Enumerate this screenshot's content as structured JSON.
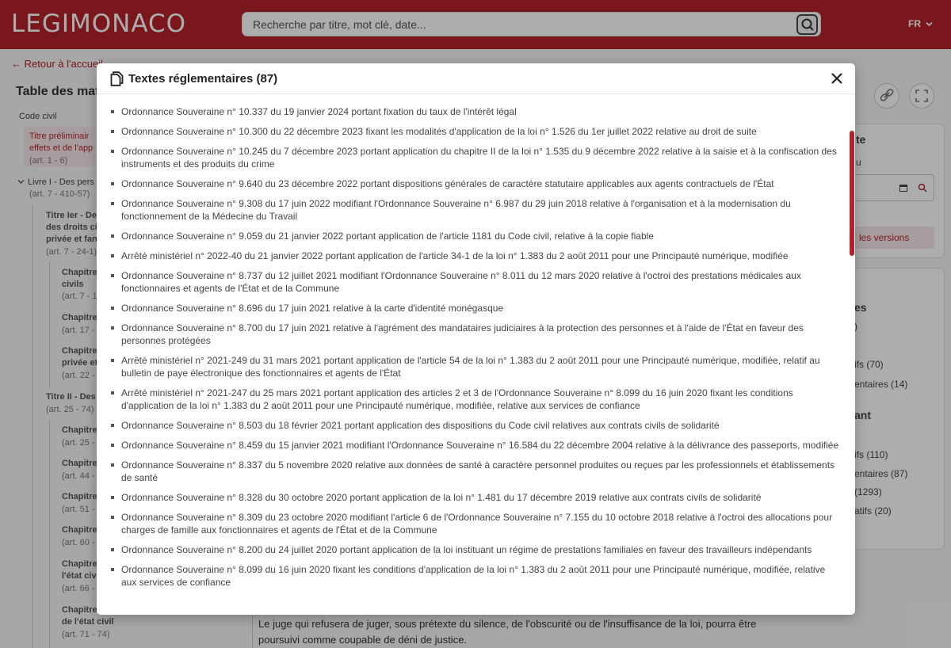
{
  "header": {
    "logo": "LEGIMONACO",
    "search_placeholder": "Recherche par titre, mot clé, date...",
    "lang": "FR"
  },
  "page": {
    "back_link": "Retour à l'accueil",
    "toc_title": "Table des mat",
    "code": "Code civil",
    "toc": [
      {
        "text": "Titre préliminair",
        "style": "red"
      },
      {
        "text": "effets et de l'app",
        "style": "red"
      },
      {
        "text": "(art. 1 - 6)",
        "style": "grey"
      },
      {
        "text": "Livre I - Des pers",
        "style": "normal"
      },
      {
        "text": "(art. 7 - 410-57)",
        "style": "grey"
      },
      {
        "text": "Titre Ier - De",
        "style": "bold"
      },
      {
        "text": "des droits civ",
        "style": "bold"
      },
      {
        "text": "privée et fan",
        "style": "bold"
      },
      {
        "text": "(art. 7 - 24-1)",
        "style": "grey"
      },
      {
        "text": "Chapitre",
        "style": "bold"
      },
      {
        "text": "civils",
        "style": "bold"
      },
      {
        "text": "(art. 7 - 1",
        "style": "grey"
      },
      {
        "text": "Chapitre",
        "style": "bold"
      },
      {
        "text": "(art. 17 -",
        "style": "grey"
      },
      {
        "text": "Chapitre",
        "style": "bold"
      },
      {
        "text": "privée et",
        "style": "bold"
      },
      {
        "text": "(art. 22 -",
        "style": "grey"
      },
      {
        "text": "Titre II - Des",
        "style": "bold"
      },
      {
        "text": "(art. 25 - 74)",
        "style": "grey"
      },
      {
        "text": "Chapitre",
        "style": "bold"
      },
      {
        "text": "(art. 25 -",
        "style": "grey"
      },
      {
        "text": "Chapitre",
        "style": "bold"
      },
      {
        "text": "(art. 44 -",
        "style": "grey"
      },
      {
        "text": "Chapitre",
        "style": "bold"
      },
      {
        "text": "(art. 51 -",
        "style": "grey"
      },
      {
        "text": "Chapitre",
        "style": "bold"
      },
      {
        "text": "(art. 60 -",
        "style": "grey"
      },
      {
        "text": "Chapitre",
        "style": "bold"
      },
      {
        "text": "l'état civ",
        "style": "bold"
      },
      {
        "text": "(art. 66 -",
        "style": "grey"
      },
      {
        "text": "Chapitre",
        "style": "bold"
      },
      {
        "text": "de l'état civil",
        "style": "bold"
      },
      {
        "text": "(art. 71 - 74)",
        "style": "grey"
      }
    ],
    "right_top": [
      "te",
      "u"
    ],
    "versions": "les versions",
    "right_lists": [
      "es",
      ")",
      "ifs (70)",
      "entaires (14)",
      "ant",
      "ifs (110)",
      "entaires (87)",
      "(1293)",
      "atifs (20)"
    ],
    "bottom_text": "Le juge qui refusera de juger, sous prétexte du silence, de l'obscurité ou de l'insuffisance de la loi, pourra être poursuivi comme coupable de déni de justice."
  },
  "modal": {
    "title": "Textes réglementaires (87)",
    "items": [
      "Ordonnance Souveraine n° 10.337 du 19 janvier 2024 portant fixation du taux de l'intérêt légal",
      "Ordonnance Souveraine n° 10.300 du 22 décembre 2023 fixant les modalités d'application de la loi n° 1.526 du 1er juillet 2022 relative au droit de suite",
      "Ordonnance Souveraine n° 10.245 du 7 décembre 2023 portant application du chapitre II de la loi n° 1.535 du 9 décembre 2022 relative à la saisie et à la confiscation des instruments et des produits du crime",
      "Ordonnance Souveraine n° 9.640 du 23 décembre 2022 portant dispositions générales de caractère statutaire applicables aux agents contractuels de l'État",
      "Ordonnance Souveraine n° 9.308 du 17 juin 2022 modifiant l'Ordonnance Souveraine n° 6.987 du 29 juin 2018 relative à l'organisation et à la modernisation du fonctionnement de la Médecine du Travail",
      "Ordonnance Souveraine n° 9.059 du 21 janvier 2022 portant application de l'article 1181 du Code civil, relative à la copie fiable",
      "Arrêté ministériel n° 2022-40 du 21 janvier 2022 portant application de l'article 34-1 de la loi n° 1.383 du 2 août 2011 pour une Principauté numérique, modifiée",
      "Ordonnance Souveraine n° 8.737 du 12 juillet 2021 modifiant l'Ordonnance Souveraine n° 8.011 du 12 mars 2020 relative à l'octroi des prestations médicales aux fonctionnaires et agents de l'État et de la Commune",
      "Ordonnance Souveraine n° 8.696 du 17 juin 2021 relative à la carte d'identité monégasque",
      "Ordonnance Souveraine n° 8.700 du 17 juin 2021 relative à l'agrément des mandataires judiciaires à la protection des personnes et à l'aide de l'État en faveur des personnes protégées",
      "Arrêté ministériel n° 2021-249 du 31 mars 2021 portant application de l'article 54 de la loi n° 1.383 du 2 août 2011 pour une Principauté numérique, modifiée, relatif au bulletin de paye électronique des fonctionnaires et agents de l'État",
      "Arrêté ministériel n° 2021-247 du 25 mars 2021 portant application des articles 2 et 3 de l'Ordonnance Souveraine n° 8.099 du 16 juin 2020 fixant les conditions d'application de la loi n° 1.383 du 2 août 2011 pour une Principauté numérique, modifiée, relative aux services de confiance",
      "Ordonnance Souveraine n° 8.503 du 18 février 2021 portant application des dispositions du Code civil relatives aux contrats civils de solidarité",
      "Ordonnance Souveraine n° 8.459 du 15 janvier 2021 modifiant l'Ordonnance Souveraine n° 16.584 du 22 décembre 2004 relative à la délivrance des passeports, modifiée",
      "Ordonnance Souveraine n° 8.337 du 5 novembre 2020 relative aux données de santé à caractère personnel produites ou reçues par les professionnels et établissements de santé",
      "Ordonnance Souveraine n° 8.328 du 30 octobre 2020 portant application de la loi n° 1.481 du 17 décembre 2019 relative aux contrats civils de solidarité",
      "Ordonnance Souveraine n° 8.309 du 23 octobre 2020 modifiant l'article 6 de l'Ordonnance Souveraine n° 7.155 du 10 octobre 2018 relative à l'octroi des allocations pour charges de famille aux fonctionnaires et agents de l'État et de la Commune",
      "Ordonnance Souveraine n° 8.200 du 24 juillet 2020 portant application de la loi instituant un régime de prestations familiales en faveur des travailleurs indépendants",
      "Ordonnance Souveraine n° 8.099 du 16 juin 2020 fixant les conditions d'application de la loi n° 1.383 du 2 août 2011 pour une Principauté numérique, modifiée, relative aux services de confiance"
    ]
  }
}
